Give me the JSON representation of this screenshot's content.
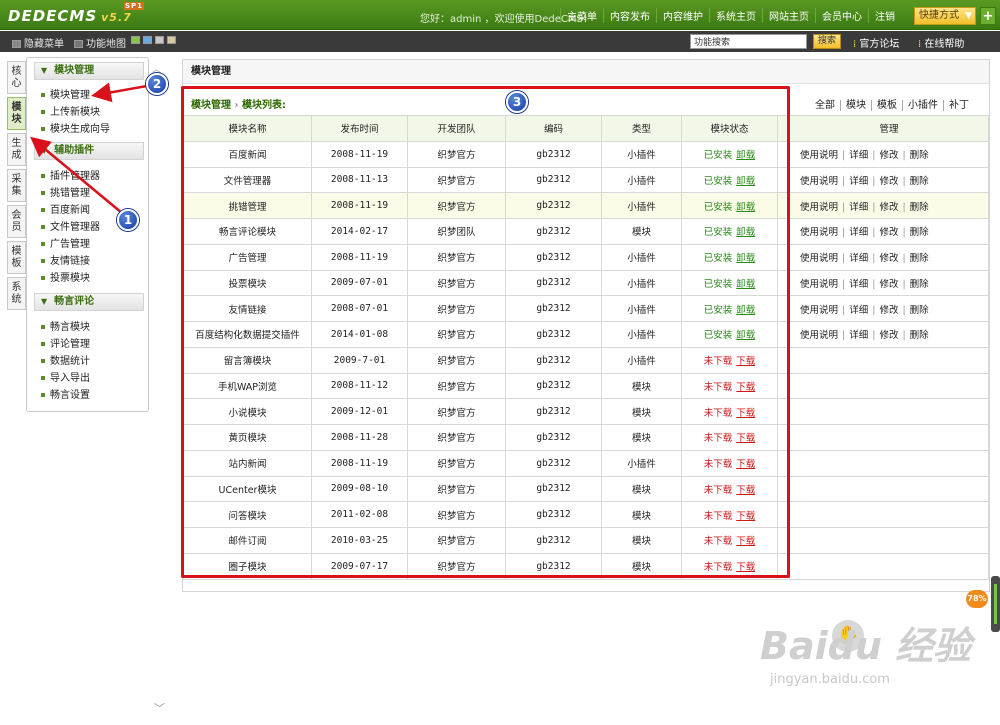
{
  "app": {
    "logo": "DEDECMS",
    "version": "v5.7",
    "badge": "SP1"
  },
  "header": {
    "greeting": "您好：admin ，欢迎使用DedeCMS！",
    "nav": [
      "主菜单",
      "内容发布",
      "内容维护",
      "系统主页",
      "网站主页",
      "会员中心",
      "注销"
    ],
    "quick": "快捷方式",
    "plus": "+"
  },
  "subbar": {
    "hide_menu": "隐藏菜单",
    "func_map": "功能地图",
    "search_placeholder": "功能搜索",
    "search_btn": "搜索",
    "forum": "官方论坛",
    "help": "在线帮助"
  },
  "vtabs": [
    "核心",
    "模块",
    "生成",
    "采集",
    "会员",
    "模板",
    "系统"
  ],
  "sidebar": {
    "groups": [
      {
        "title": "模块管理",
        "items": [
          "模块管理",
          "上传新模块",
          "模块生成向导"
        ]
      },
      {
        "title": "辅助插件",
        "items": [
          "插件管理器",
          "挑错管理",
          "百度新闻",
          "文件管理器",
          "广告管理",
          "友情链接",
          "投票模块"
        ]
      },
      {
        "title": "畅言评论",
        "items": [
          "畅言模块",
          "评论管理",
          "数据统计",
          "导入导出",
          "畅言设置"
        ]
      }
    ]
  },
  "main": {
    "title": "模块管理",
    "breadcrumb": {
      "root": "模块管理",
      "sep": "›",
      "current": "模块列表:"
    },
    "filters": [
      "全部",
      "模块",
      "模板",
      "小插件",
      "补丁"
    ],
    "columns": [
      "模块名称",
      "发布时间",
      "开发团队",
      "编码",
      "类型",
      "模块状态",
      "",
      "管理"
    ],
    "rows": [
      {
        "name": "百度新闻",
        "date": "2008-11-19",
        "team": "织梦官方",
        "code": "gb2312",
        "type": "小插件",
        "status": "已安装",
        "action": "卸载",
        "installed": true
      },
      {
        "name": "文件管理器",
        "date": "2008-11-13",
        "team": "织梦官方",
        "code": "gb2312",
        "type": "小插件",
        "status": "已安装",
        "action": "卸载",
        "installed": true
      },
      {
        "name": "挑错管理",
        "date": "2008-11-19",
        "team": "织梦官方",
        "code": "gb2312",
        "type": "小插件",
        "status": "已安装",
        "action": "卸载",
        "installed": true
      },
      {
        "name": "畅言评论模块",
        "date": "2014-02-17",
        "team": "织梦团队",
        "code": "gb2312",
        "type": "模块",
        "status": "已安装",
        "action": "卸载",
        "installed": true
      },
      {
        "name": "广告管理",
        "date": "2008-11-19",
        "team": "织梦官方",
        "code": "gb2312",
        "type": "小插件",
        "status": "已安装",
        "action": "卸载",
        "installed": true
      },
      {
        "name": "投票模块",
        "date": "2009-07-01",
        "team": "织梦官方",
        "code": "gb2312",
        "type": "小插件",
        "status": "已安装",
        "action": "卸载",
        "installed": true
      },
      {
        "name": "友情链接",
        "date": "2008-07-01",
        "team": "织梦官方",
        "code": "gb2312",
        "type": "小插件",
        "status": "已安装",
        "action": "卸载",
        "installed": true
      },
      {
        "name": "百度结构化数据提交插件",
        "date": "2014-01-08",
        "team": "织梦官方",
        "code": "gb2312",
        "type": "小插件",
        "status": "已安装",
        "action": "卸载",
        "installed": true
      },
      {
        "name": "留言簿模块",
        "date": "2009-7-01",
        "team": "织梦官方",
        "code": "gb2312",
        "type": "小插件",
        "status": "未下载",
        "action": "下载",
        "installed": false
      },
      {
        "name": "手机WAP浏览",
        "date": "2008-11-12",
        "team": "织梦官方",
        "code": "gb2312",
        "type": "模块",
        "status": "未下载",
        "action": "下载",
        "installed": false
      },
      {
        "name": "小说模块",
        "date": "2009-12-01",
        "team": "织梦官方",
        "code": "gb2312",
        "type": "模块",
        "status": "未下载",
        "action": "下载",
        "installed": false
      },
      {
        "name": "黄页模块",
        "date": "2008-11-28",
        "team": "织梦官方",
        "code": "gb2312",
        "type": "模块",
        "status": "未下载",
        "action": "下载",
        "installed": false
      },
      {
        "name": "站内新闻",
        "date": "2008-11-19",
        "team": "织梦官方",
        "code": "gb2312",
        "type": "小插件",
        "status": "未下载",
        "action": "下载",
        "installed": false
      },
      {
        "name": "UCenter模块",
        "date": "2009-08-10",
        "team": "织梦官方",
        "code": "gb2312",
        "type": "模块",
        "status": "未下载",
        "action": "下载",
        "installed": false
      },
      {
        "name": "问答模块",
        "date": "2011-02-08",
        "team": "织梦官方",
        "code": "gb2312",
        "type": "模块",
        "status": "未下载",
        "action": "下载",
        "installed": false
      },
      {
        "name": "邮件订阅",
        "date": "2010-03-25",
        "team": "织梦官方",
        "code": "gb2312",
        "type": "模块",
        "status": "未下载",
        "action": "下载",
        "installed": false
      },
      {
        "name": "圈子模块",
        "date": "2009-07-17",
        "team": "织梦官方",
        "code": "gb2312",
        "type": "模块",
        "status": "未下载",
        "action": "下载",
        "installed": false
      }
    ],
    "manage_actions": [
      "使用说明",
      "详细",
      "修改",
      "删除"
    ]
  },
  "markers": [
    "1",
    "2",
    "3"
  ],
  "overlay": {
    "percent": "78%",
    "watermark": "Baidu 经验",
    "watermark_url": "jingyan.baidu.com"
  },
  "colors": {
    "brand": "#3b7a12",
    "highlight": "#d8111b",
    "installed": "#2a8a1a",
    "missing": "#cc1a1a"
  }
}
